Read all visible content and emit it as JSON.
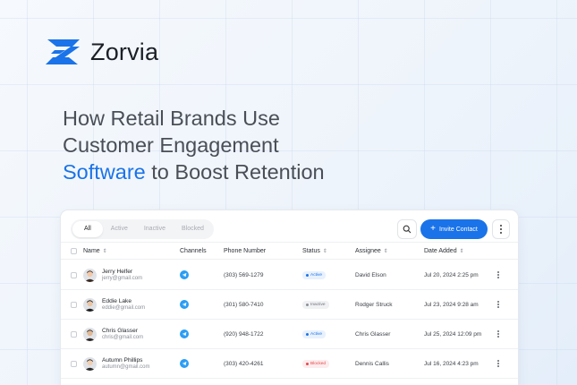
{
  "brand": {
    "name": "Zorvia",
    "logo_icon": "zorvia-logo-icon",
    "accent": "#1a73e8"
  },
  "headline": {
    "line1": "How Retail Brands Use",
    "line2": "Customer Engagement",
    "line3_highlight": "Software",
    "line3_rest": " to Boost Retention"
  },
  "toolbar": {
    "tabs": [
      "All",
      "Active",
      "Inactive",
      "Blocked"
    ],
    "selected_tab": "All",
    "invite_label": "Invite Contact",
    "search_icon": "search-icon",
    "more_icon": "more-vertical-icon"
  },
  "table": {
    "columns": {
      "name": "Name",
      "channels": "Channels",
      "phone": "Phone Number",
      "status": "Status",
      "assignee": "Assignee",
      "date": "Date Added"
    },
    "rows": [
      {
        "name": "Jerry Helfer",
        "email": "jerry@gmail.com",
        "channel_icon": "telegram-icon",
        "phone": "(303) 569-1279",
        "status": "Active",
        "assignee": "David Elson",
        "date": "Jul 20, 2024 2:25 pm"
      },
      {
        "name": "Eddie Lake",
        "email": "eddie@gmail.com",
        "channel_icon": "telegram-icon",
        "phone": "(301) 580-7410",
        "status": "Inactive",
        "assignee": "Rodger Struck",
        "date": "Jul 23, 2024 9:28 am"
      },
      {
        "name": "Chris Glasser",
        "email": "chris@gmail.com",
        "channel_icon": "telegram-icon",
        "phone": "(920) 948-1722",
        "status": "Active",
        "assignee": "Chris Glasser",
        "date": "Jul 25, 2024 12:09 pm"
      },
      {
        "name": "Autumn Phillips",
        "email": "autumn@gmail.com",
        "channel_icon": "telegram-icon",
        "phone": "(303) 420-4261",
        "status": "Blocked",
        "assignee": "Dennis Callis",
        "date": "Jul 16, 2024 4:23 pm"
      }
    ]
  },
  "status_colors": {
    "Active": "#1a73e8",
    "Inactive": "#8b9098",
    "Blocked": "#e5484d"
  }
}
